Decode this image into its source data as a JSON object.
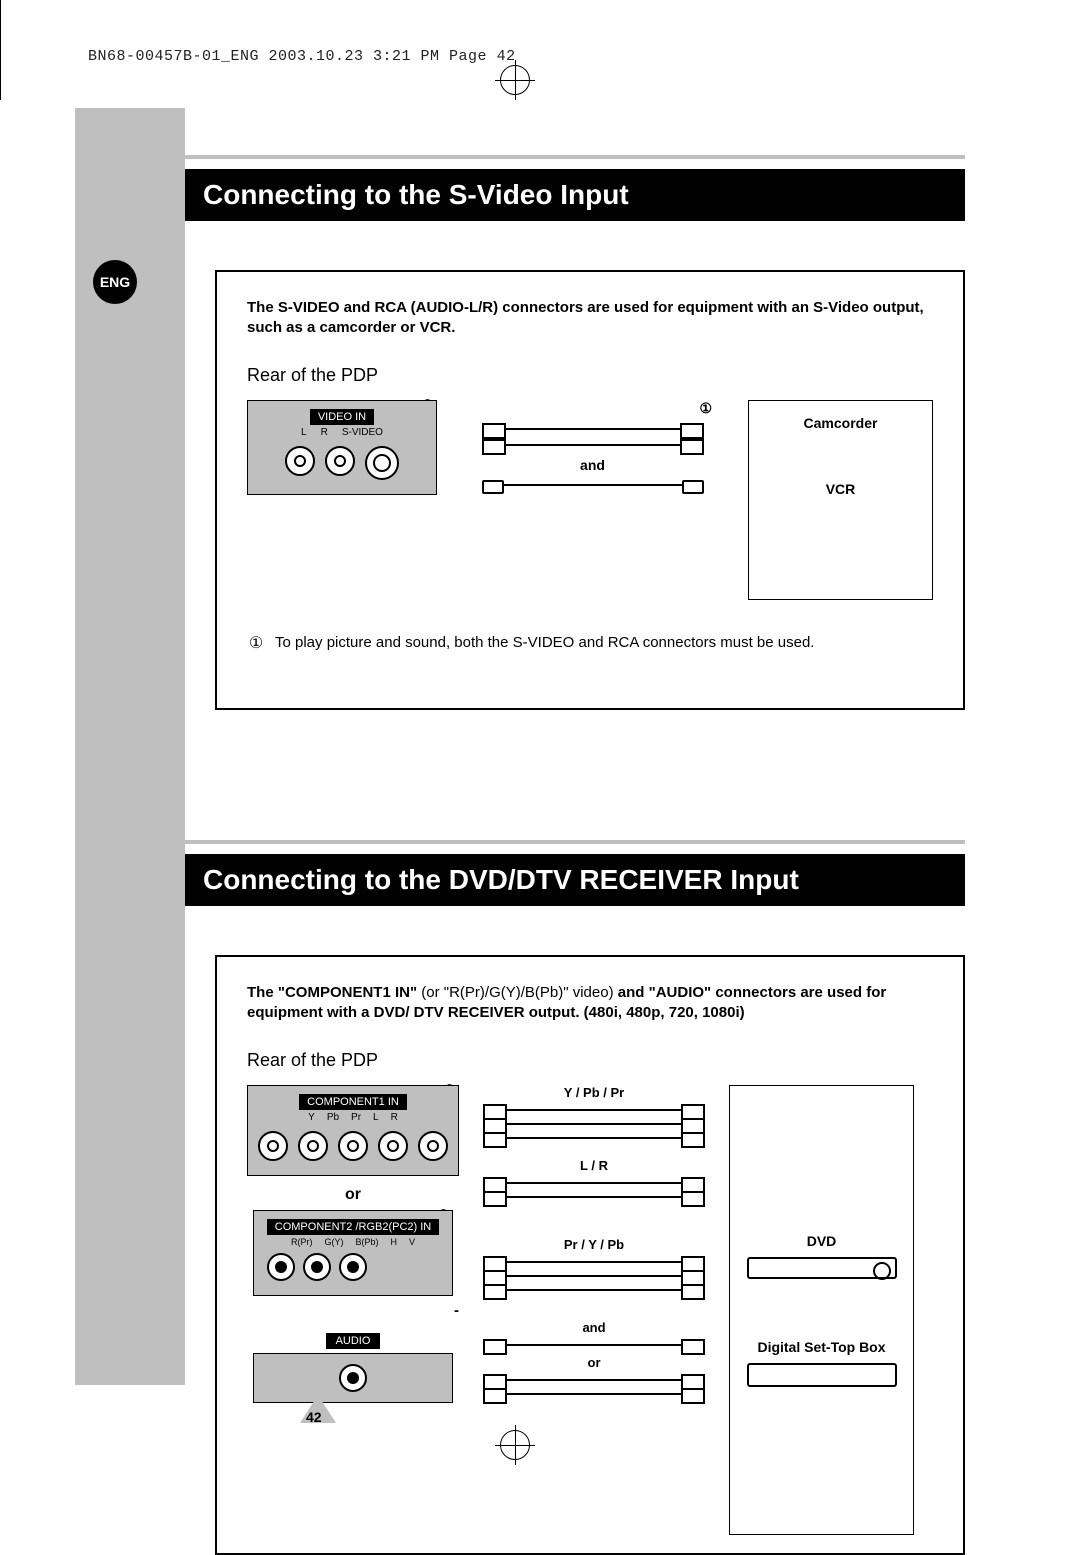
{
  "header": "BN68-00457B-01_ENG  2003.10.23  3:21 PM  Page 42",
  "lang_badge": "ENG",
  "page_number": "42",
  "section1": {
    "title": "Connecting to the S-Video Input",
    "intro_bold": "The S-VIDEO and RCA (AUDIO-L/R) connectors are used for equipment with an S-Video output, such as a camcorder or VCR.",
    "rear_label": "Rear of the PDP",
    "panel_label": "VIDEO IN",
    "panel_sub_l": "L",
    "panel_sub_r": "R",
    "panel_sub_sv": "S-VIDEO",
    "cable_marker": "①",
    "cable_and": "and",
    "devices": {
      "camcorder": "Camcorder",
      "vcr": "VCR"
    },
    "note_marker": "①",
    "note_text": "To play picture and sound, both the S-VIDEO and RCA connectors must be used."
  },
  "section2": {
    "title": "Connecting to the DVD/DTV RECEIVER Input",
    "intro_pre": "The \"COMPONENT1 IN\" ",
    "intro_light": "(or \"R(Pr)/G(Y)/B(Pb)\" video)",
    "intro_post": " and \"AUDIO\" connectors are used for equipment with a DVD/ DTV RECEIVER output. (480i, 480p, 720, 1080i)",
    "rear_label": "Rear of the PDP",
    "panel1_label": "COMPONENT1 IN",
    "panel1_sub": {
      "y": "Y",
      "pb": "Pb",
      "pr": "Pr",
      "l": "L",
      "r": "R"
    },
    "or": "or",
    "panel2_label": "COMPONENT2 /RGB2(PC2) IN",
    "panel2_sub": {
      "rpr": "R(Pr)",
      "gy": "G(Y)",
      "bpb": "B(Pb)",
      "h": "H",
      "v": "V"
    },
    "audio_label": "AUDIO",
    "cable_ypbpr": "Y / Pb / Pr",
    "cable_lr": "L / R",
    "cable_prypb": "Pr / Y / Pb",
    "cable_and": "and",
    "cable_or": "or",
    "devices": {
      "dvd": "DVD",
      "stb": "Digital Set-Top Box"
    }
  }
}
